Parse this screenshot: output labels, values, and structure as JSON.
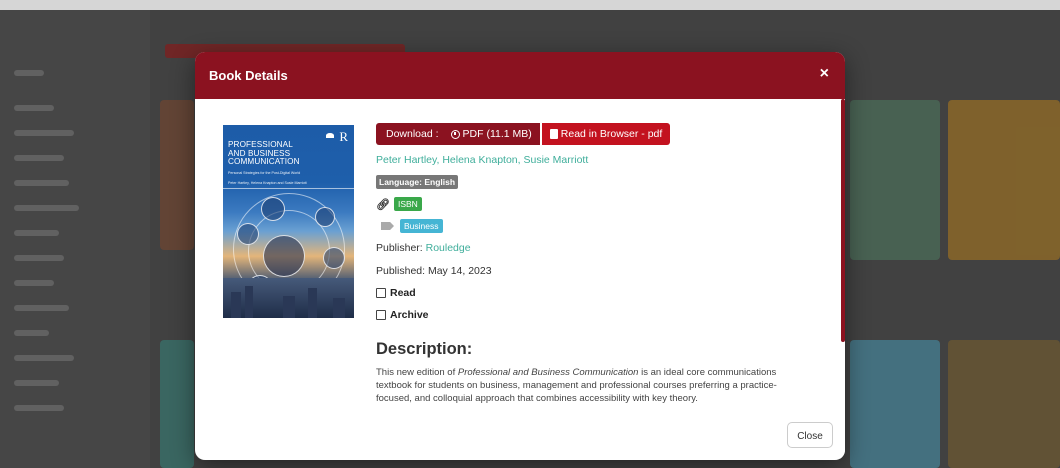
{
  "modal": {
    "title": "Book Details",
    "close_icon": "×",
    "close_button_label": "Close"
  },
  "download": {
    "label": "Download :",
    "pdf_label": "PDF (11.1 MB)",
    "read_label": "Read in Browser - pdf"
  },
  "cover": {
    "title_line1": "PROFESSIONAL",
    "title_line2": "AND BUSINESS",
    "title_line3": "COMMUNICATION",
    "subtitle": "Personal Strategies for the Post-Digital World",
    "authors": "Peter Hartley, Helena Knapton and Susie Marriott",
    "logo": "R"
  },
  "book": {
    "authors": "Peter Hartley, Helena Knapton, Susie Marriott",
    "language": "Language: English",
    "isbn_label": "ISBN",
    "tag": "Business",
    "publisher_label": "Publisher:",
    "publisher": "Rouledge",
    "published": "Published: May 14, 2023",
    "read_label": "Read",
    "archive_label": "Archive"
  },
  "description": {
    "heading": "Description:",
    "text_pre": "This new edition of ",
    "text_title": "Professional and Business Communication",
    "text_post": " is an ideal core communications textbook for students on business, management and professional courses preferring a practice-focused, and colloquial approach that combines accessibility with key theory."
  },
  "colors": {
    "brand": "#8b1220",
    "read_button": "#c3121f",
    "link": "#3fae9b",
    "isbn_badge": "#3aa84a",
    "tag_badge": "#45b5d4"
  },
  "icons": {
    "pdf": "download-circle-icon",
    "read": "book-icon",
    "isbn": "link-icon",
    "tag": "tag-icon",
    "close": "close-icon"
  }
}
